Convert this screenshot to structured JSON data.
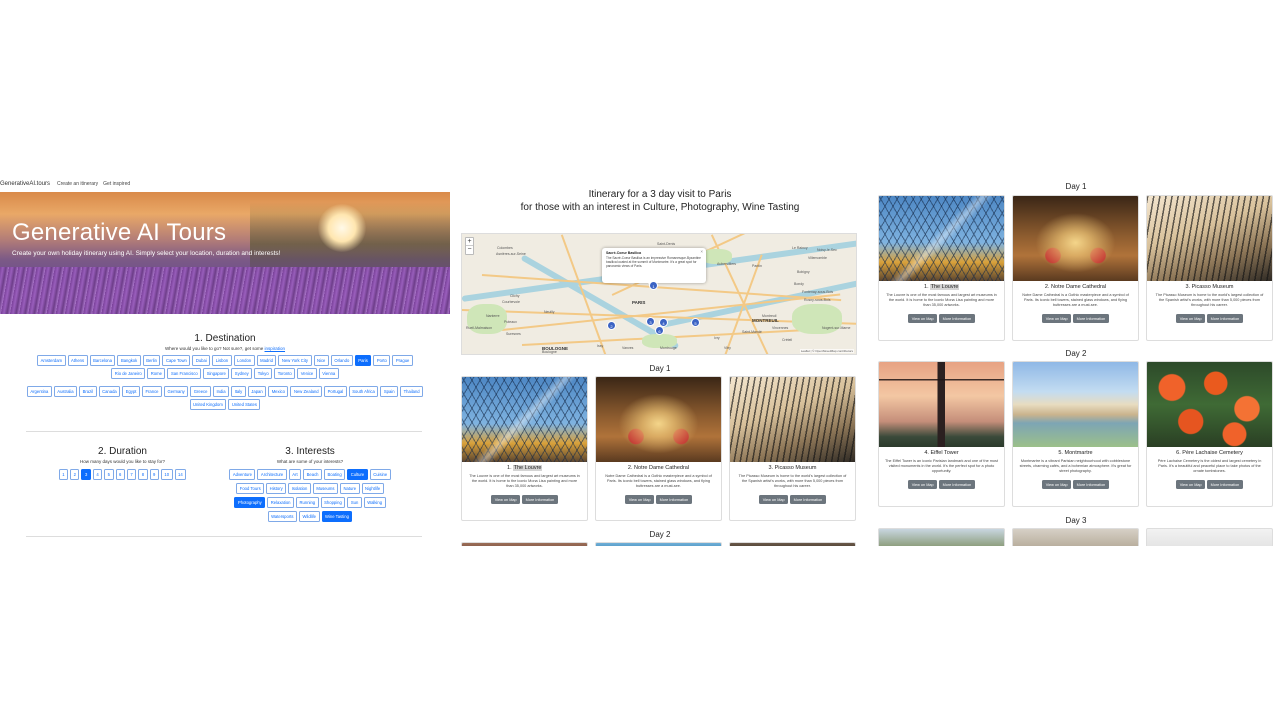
{
  "nav": {
    "brand": "GenerativeAI.tours",
    "links": [
      "Create an itinerary",
      "Get inspired"
    ]
  },
  "hero": {
    "title": "Generative AI Tours",
    "subtitle": "Create your own holiday itinerary using AI. Simply select your location, duration and interests!"
  },
  "destination": {
    "title": "1. Destination",
    "subtitle_prefix": "Where would you like to go? Not sure?, get some ",
    "subtitle_link": "inspiration",
    "cities": [
      "Amsterdam",
      "Athens",
      "Barcelona",
      "Bangkok",
      "Berlin",
      "Cape Town",
      "Dubai",
      "Lisbon",
      "London",
      "Madrid",
      "New York City",
      "Nice",
      "Orlando",
      "Paris",
      "Porto",
      "Prague",
      "Rio de Janeiro",
      "Rome",
      "San Francisco",
      "Singapore",
      "Sydney",
      "Tokyo",
      "Toronto",
      "Venice",
      "Vienna"
    ],
    "selected_city": "Paris",
    "countries": [
      "Argentina",
      "Australia",
      "Brazil",
      "Canada",
      "Egypt",
      "France",
      "Germany",
      "Greece",
      "India",
      "Italy",
      "Japan",
      "Mexico",
      "New Zealand",
      "Portugal",
      "South Africa",
      "Spain",
      "Thailand",
      "United Kingdom",
      "United States"
    ]
  },
  "duration": {
    "title": "2. Duration",
    "subtitle": "How many days would you like to stay for?",
    "options": [
      "1",
      "2",
      "3",
      "4",
      "5",
      "6",
      "7",
      "8",
      "9",
      "10",
      "14"
    ],
    "selected": "3"
  },
  "interests": {
    "title": "3. Interests",
    "subtitle": "What are some of your interests?",
    "rows": [
      [
        "Adventure",
        "Architecture",
        "Art",
        "Beach",
        "Boating",
        "Culture",
        "Cuisine"
      ],
      [
        "Food Tours",
        "History",
        "Isolation",
        "Museums",
        "Nature",
        "Nightlife"
      ],
      [
        "Photography",
        "Relaxation",
        "Running",
        "Shopping",
        "Sun",
        "Walking"
      ],
      [
        "Watersports",
        "Wildlife",
        "Wine Tasting"
      ]
    ],
    "selected": [
      "Culture",
      "Photography",
      "Wine Tasting"
    ]
  },
  "itinerary": {
    "title_line1": "Itinerary for a 3 day visit to Paris",
    "title_line2": "for those with an interest in Culture, Photography, Wine Tasting"
  },
  "map": {
    "zoom_in": "+",
    "zoom_out": "−",
    "popup_title": "Sacré-Coeur Basilica",
    "popup_text": "The Sacré-Coeur Basilica is an impressive Romanesque-Byzantine basilica located at the summit of Montmartre. It's a great spot for panoramic views of Paris.",
    "popup_close": "×",
    "labels": [
      "Colombes",
      "Asnières-sur-Seine",
      "Clichy",
      "Saint-Denis",
      "Aubervilliers",
      "Pantin",
      "Bobigny",
      "Bondy",
      "Noisy-le-Sec",
      "Rosny-sous-Bois",
      "Montreuil",
      "Vincennes",
      "Nanterre",
      "Courbevoie",
      "Puteaux",
      "Suresnes",
      "Boulogne",
      "Issy",
      "Vanves",
      "Montrouge",
      "Ivry",
      "Vitry",
      "Créteil",
      "Saint-Mandé",
      "Neuilly",
      "Rueil-Malmaison",
      "Villemomble",
      "Le Raincy",
      "Fontenay-sous-Bois",
      "Nogent-sur-Marne"
    ],
    "big_labels": [
      "PARIS",
      "MONTREUIL",
      "BOULOGNE"
    ],
    "markers": [
      "1",
      "2",
      "3",
      "4",
      "5",
      "6"
    ],
    "attribution": "Leaflet | © OpenStreetMap contributors"
  },
  "days": [
    {
      "label": "Day 1",
      "places": [
        {
          "num": "1. ",
          "name": "The Louvre",
          "desc": "The Louvre is one of the most famous and largest art museums in the world. It is home to the iconic Mona Lisa painting and more than 35,000 artworks."
        },
        {
          "num": "2. ",
          "name": "Notre Dame Cathedral",
          "desc": "Notre Dame Cathedral is a Gothic masterpiece and a symbol of Paris. Its iconic bell towers, stained glass windows, and flying buttresses are a must-see."
        },
        {
          "num": "3. ",
          "name": "Picasso Museum",
          "desc": "The Picasso Museum is home to the world's largest collection of the Spanish artist's works, with more than 5,000 pieces from throughout his career."
        }
      ]
    },
    {
      "label": "Day 2",
      "places": [
        {
          "num": "4. ",
          "name": "Eiffel Tower",
          "desc": "The Eiffel Tower is an iconic Parisian landmark and one of the most visited monuments in the world. It's the perfect spot for a photo opportunity."
        },
        {
          "num": "5. ",
          "name": "Montmartre",
          "desc": "Montmartre is a vibrant Parisian neighbourhood with cobblestone streets, charming cafés, and a bohemian atmosphere. It's great for street photography."
        },
        {
          "num": "6. ",
          "name": "Père Lachaise Cemetery",
          "desc": "Père Lachaise Cemetery is the oldest and largest cemetery in Paris. It's a beautiful and peaceful place to take photos of the ornate tombstones."
        }
      ]
    },
    {
      "label": "Day 3"
    }
  ],
  "buttons": {
    "view_on_map": "View on Map",
    "more_info": "More Information"
  }
}
